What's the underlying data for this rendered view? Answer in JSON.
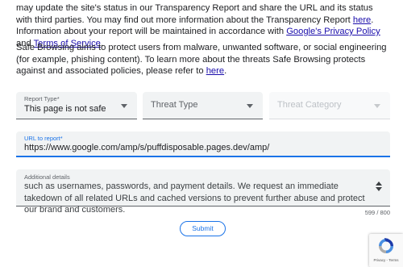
{
  "intro": {
    "p1_text1": "may update the site's status in our Transparency Report and share the URL and its status with third parties. You may find out more information about the Transparency Report ",
    "p1_link1": "here",
    "p1_text2": ". Information about your report will be maintained in accordance with ",
    "p1_link2": "Google's Privacy Policy",
    "p1_text3": " and ",
    "p1_link3": "Terms of Service",
    "p1_text4": ".",
    "p2_text1": "Safe Browsing aims to protect users from malware, unwanted software, or social engineering (for example, phishing content). To learn more about the threats Safe Browsing protects against and associated policies, please refer to ",
    "p2_link1": "here",
    "p2_text2": "."
  },
  "form": {
    "report_type": {
      "label": "Report Type*",
      "value": "This page is not safe"
    },
    "threat_type": {
      "placeholder": "Threat Type"
    },
    "threat_category": {
      "placeholder": "Threat Category"
    },
    "url": {
      "label": "URL to report*",
      "value": "https://www.google.com/amp/s/puffdisposable.pages.dev/amp/"
    },
    "details": {
      "label": "Additional details",
      "value": "such as usernames, passwords, and payment details. We request an immediate takedown of all related URLs and cached versions to prevent further abuse and protect our brand and customers.",
      "counter": "599 / 800"
    },
    "submit_label": "Submit"
  },
  "recaptcha": {
    "links": "Privacy - Terms",
    "icon": "recaptcha-icon"
  },
  "colors": {
    "link": "#1a0dab",
    "accent": "#1a73e8",
    "field_bg": "#f1f3f4"
  }
}
